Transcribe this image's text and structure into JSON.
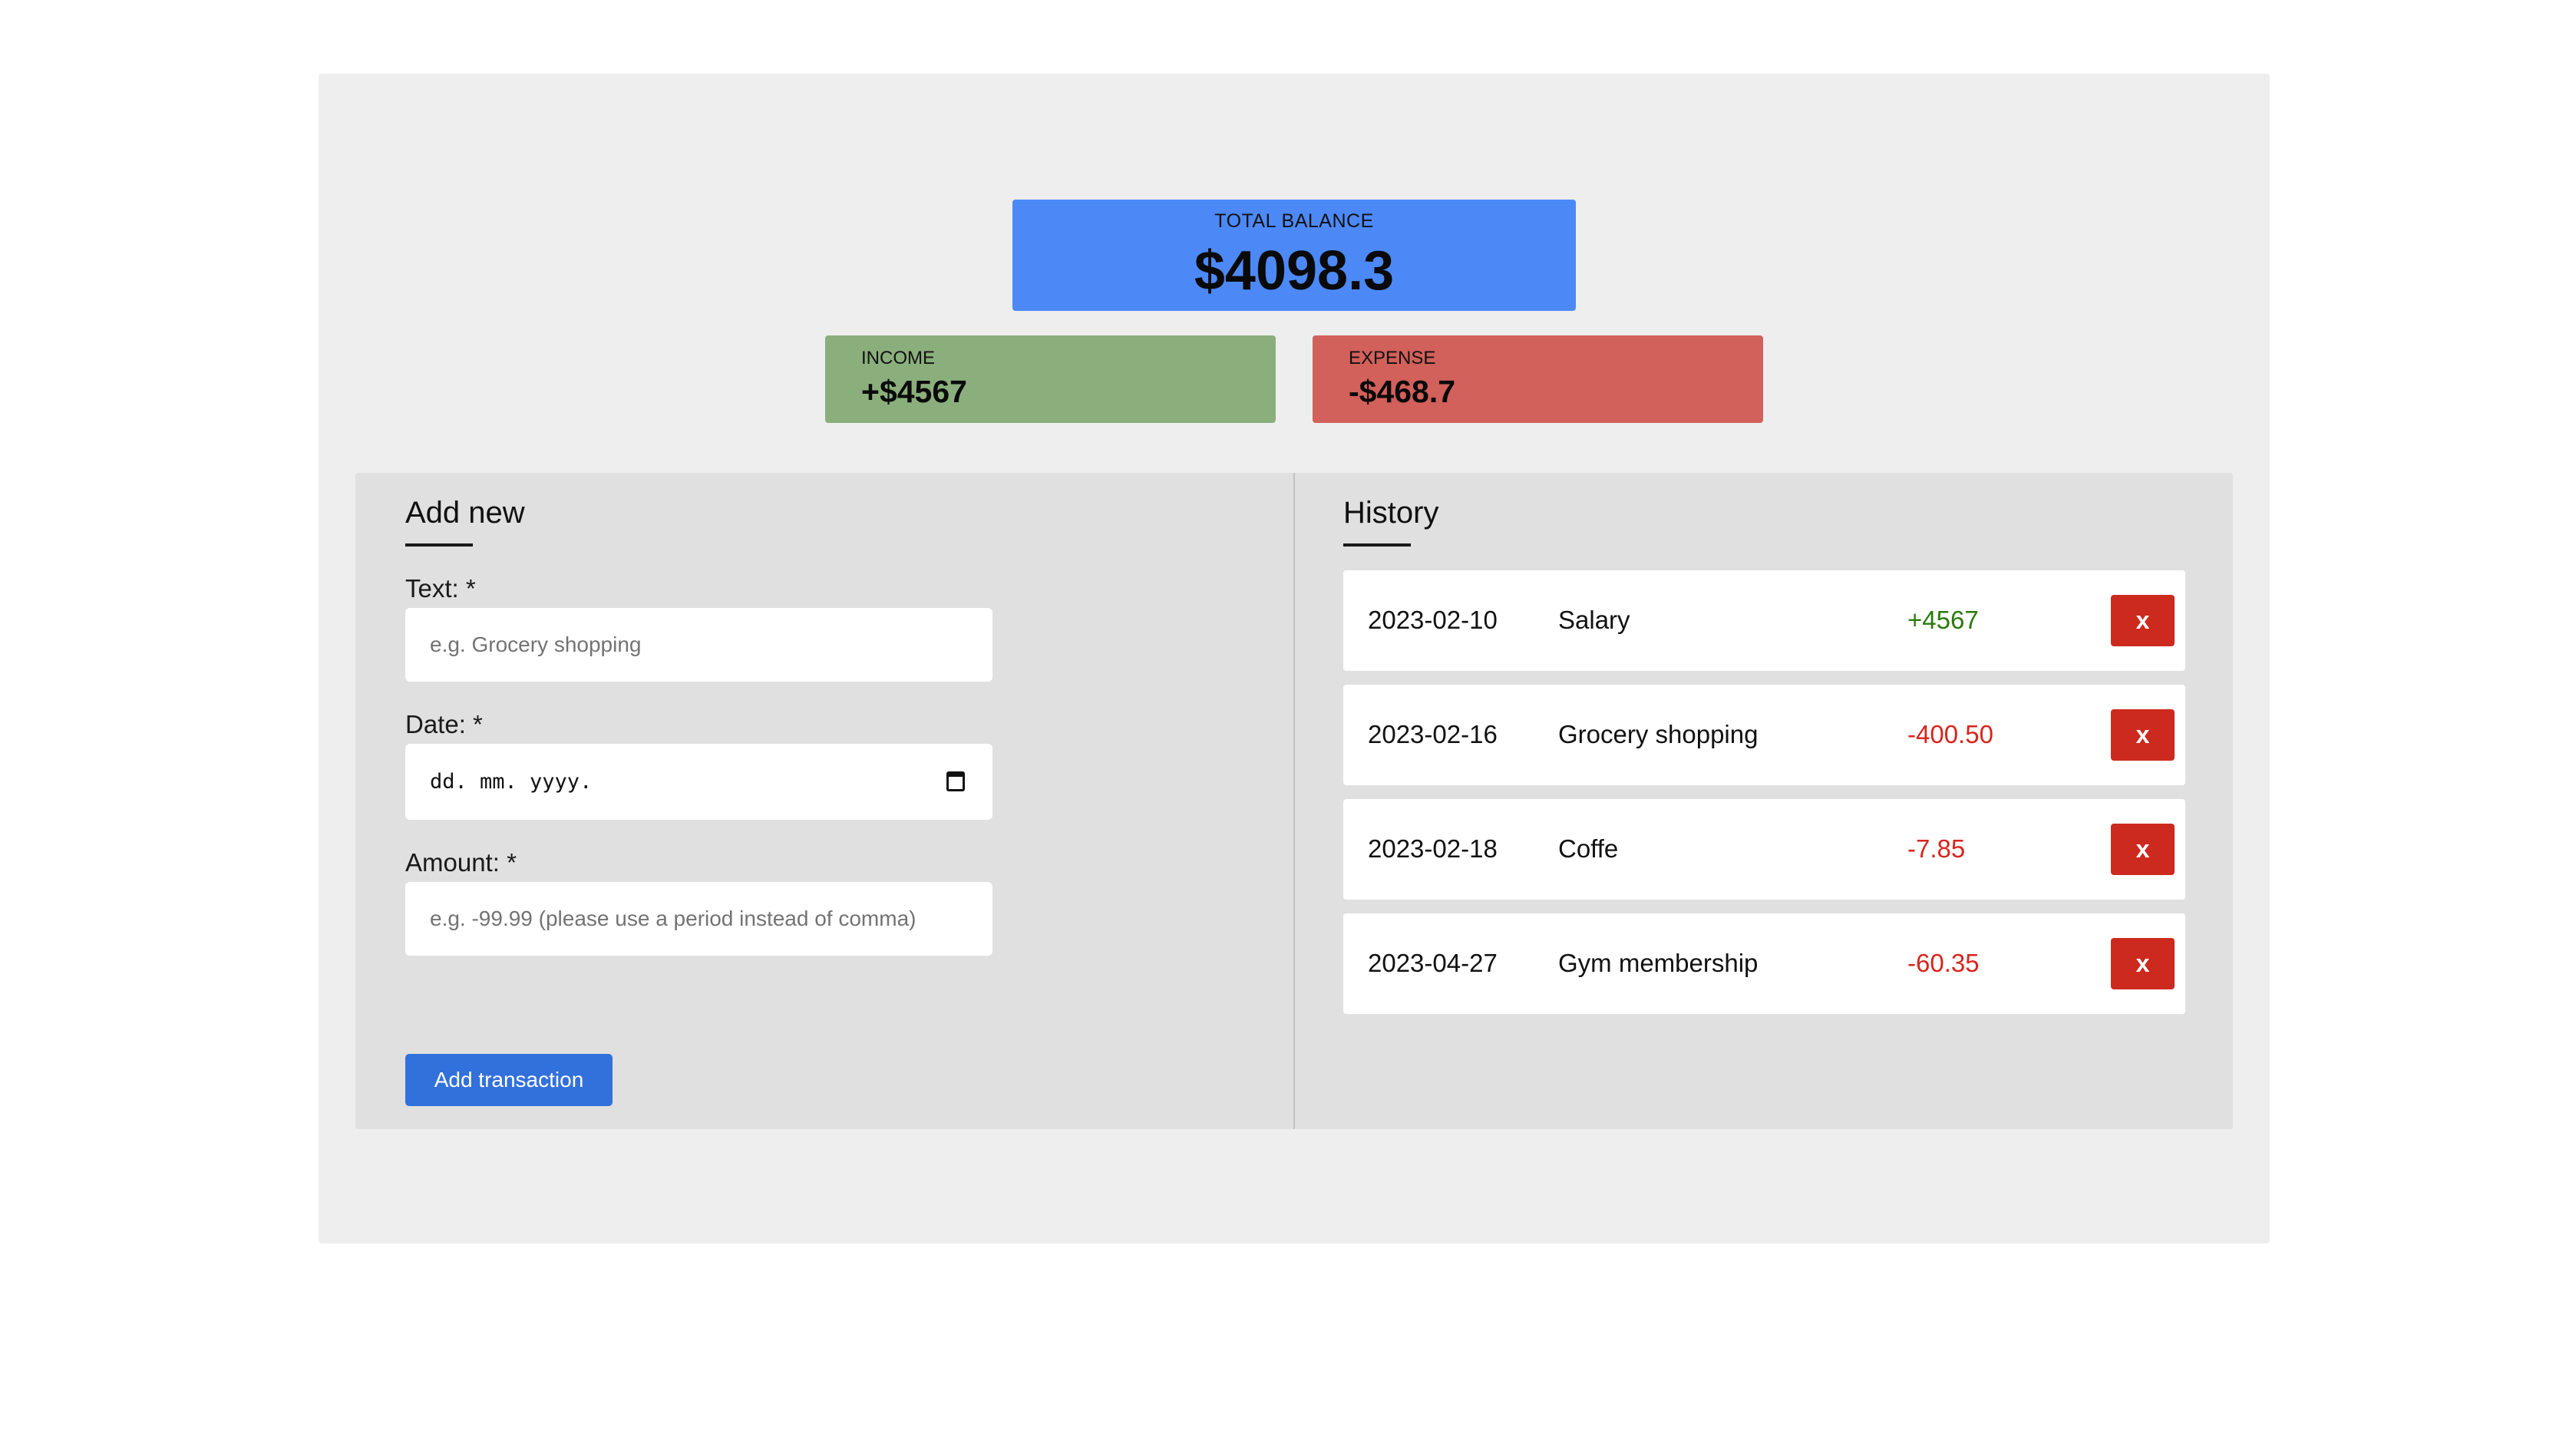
{
  "balance": {
    "total_label": "TOTAL BALANCE",
    "total_value": "$4098.3",
    "income_label": "INCOME",
    "income_value": "+$4567",
    "expense_label": "EXPENSE",
    "expense_value": "-$468.7"
  },
  "add_new": {
    "title": "Add new",
    "text_label": "Text: *",
    "text_placeholder": "e.g. Grocery shopping",
    "date_label": "Date: *",
    "date_value": "dd. mm. yyyy.",
    "amount_label": "Amount: *",
    "amount_placeholder": "e.g. -99.99 (please use a period instead of comma)",
    "submit_label": "Add transaction"
  },
  "history": {
    "title": "History",
    "delete_label": "x",
    "items": [
      {
        "date": "2023-02-10",
        "text": "Salary",
        "amount": "+4567"
      },
      {
        "date": "2023-02-16",
        "text": "Grocery shopping",
        "amount": "-400.50"
      },
      {
        "date": "2023-02-18",
        "text": "Coffe",
        "amount": "-7.85"
      },
      {
        "date": "2023-04-27",
        "text": "Gym membership",
        "amount": "-60.35"
      }
    ]
  },
  "colors": {
    "total_card": "#4c89f7",
    "income_card": "#8aaf7c",
    "expense_card": "#d2605b",
    "positive_amount": "#2b7a0b",
    "negative_amount": "#d7251d",
    "primary_button": "#3271dc",
    "delete_button": "#cc2a1f"
  },
  "icons": {
    "date_picker": "calendar-icon"
  }
}
